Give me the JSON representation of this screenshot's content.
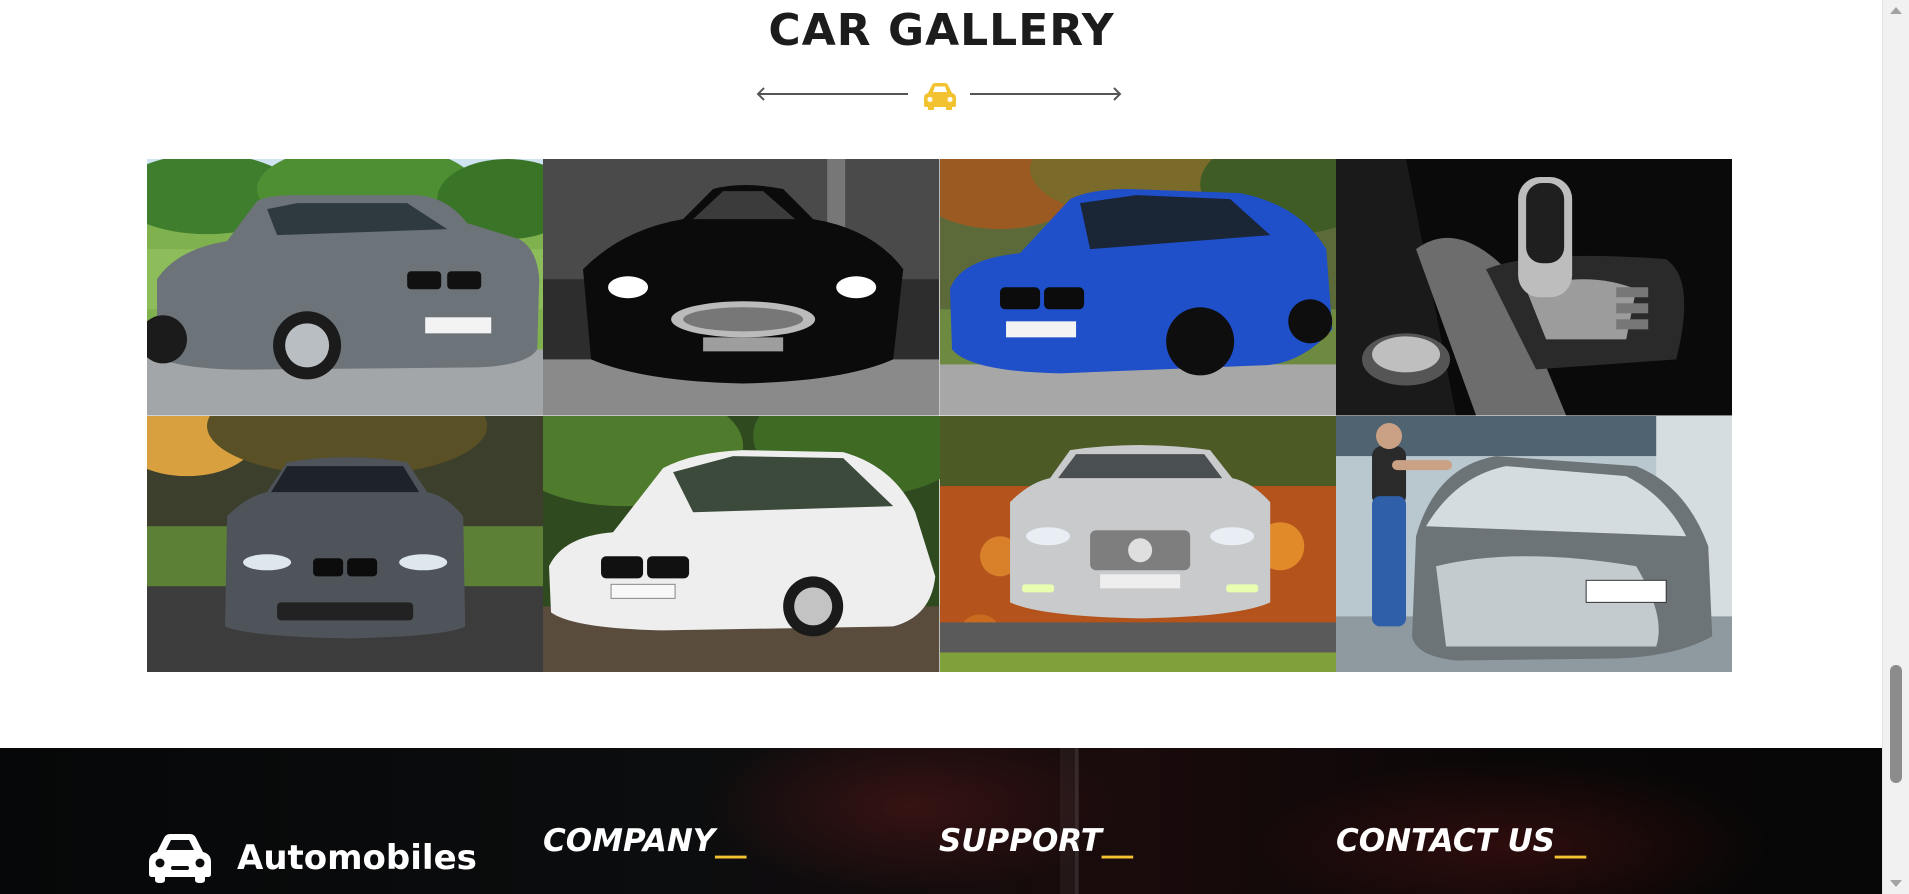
{
  "gallery": {
    "title": "CAR GALLERY",
    "divider_icon": "car-icon",
    "accent_color": "#f2c230",
    "images": [
      {
        "name": "gallery-image-silver-bmw-sedan",
        "subject": "silver-bmw-sedan"
      },
      {
        "name": "gallery-image-black-jaguar",
        "subject": "black-jaguar"
      },
      {
        "name": "gallery-image-blue-bmw",
        "subject": "blue-bmw"
      },
      {
        "name": "gallery-image-gear-shifter",
        "subject": "gear-shifter"
      },
      {
        "name": "gallery-image-grey-bmw-m4",
        "subject": "grey-bmw-m4"
      },
      {
        "name": "gallery-image-white-bmw",
        "subject": "white-bmw"
      },
      {
        "name": "gallery-image-silver-mercedes",
        "subject": "silver-mercedes"
      },
      {
        "name": "gallery-image-car-wash",
        "subject": "car-wash"
      }
    ]
  },
  "footer": {
    "brand": {
      "icon": "car-icon",
      "name": "Automobiles"
    },
    "columns": [
      {
        "title": "COMPANY",
        "accent": "__"
      },
      {
        "title": "SUPPORT",
        "accent": "__"
      },
      {
        "title": "CONTACT US",
        "accent": "__"
      }
    ]
  }
}
